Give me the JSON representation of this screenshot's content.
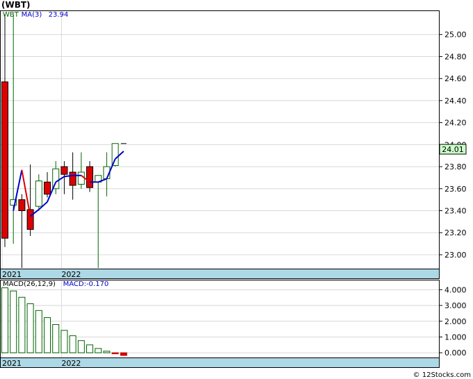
{
  "title": "(WBT)",
  "footer": "© 12Stocks.com",
  "colors": {
    "up_candle": "#006400",
    "down_candle": "#dd0000",
    "ma_up": "#0000cc",
    "ma_down": "#dd0000",
    "macd_bar": "#006400",
    "macd_negative": "#cc0000",
    "axis_band": "#add8e6",
    "price_tag_bg": "#ccffcc"
  },
  "chart_data": [
    {
      "type": "candlestick",
      "name": "price-chart",
      "legend": [
        {
          "text": "WBT",
          "color": "#006400"
        },
        {
          "text": "MA(3)",
          "color": "#0000cc"
        },
        {
          "text": "23.94",
          "color": "#0000cc"
        }
      ],
      "ylim": [
        22.88,
        25.2
      ],
      "yticks": [
        23.0,
        23.2,
        23.4,
        23.6,
        23.8,
        24.0,
        24.2,
        24.4,
        24.6,
        24.8,
        25.0
      ],
      "ytick_labels": [
        "23.00",
        "23.20",
        "23.40",
        "23.60",
        "23.80",
        "24.00",
        "24.20",
        "24.40",
        "24.60",
        "24.80",
        "25.00"
      ],
      "x_labels": [
        {
          "text": "2021",
          "index": 0
        },
        {
          "text": "2022",
          "index": 7
        }
      ],
      "last_price": "24.01",
      "candles": [
        {
          "o": 24.57,
          "h": 25.18,
          "l": 23.07,
          "c": 23.15
        },
        {
          "o": 23.45,
          "h": 25.18,
          "l": 23.1,
          "c": 23.5
        },
        {
          "o": 23.5,
          "h": 23.55,
          "l": 22.88,
          "c": 23.4
        },
        {
          "o": 23.41,
          "h": 23.82,
          "l": 23.17,
          "c": 23.23
        },
        {
          "o": 23.44,
          "h": 23.73,
          "l": 23.4,
          "c": 23.67
        },
        {
          "o": 23.66,
          "h": 23.75,
          "l": 23.52,
          "c": 23.55
        },
        {
          "o": 23.6,
          "h": 23.85,
          "l": 23.55,
          "c": 23.78
        },
        {
          "o": 23.8,
          "h": 23.85,
          "l": 23.55,
          "c": 23.73
        },
        {
          "o": 23.75,
          "h": 23.93,
          "l": 23.5,
          "c": 23.63
        },
        {
          "o": 23.64,
          "h": 23.93,
          "l": 23.6,
          "c": 23.75
        },
        {
          "o": 23.8,
          "h": 23.85,
          "l": 23.57,
          "c": 23.61
        },
        {
          "o": 23.66,
          "h": 23.71,
          "l": 22.88,
          "c": 23.72
        },
        {
          "o": 23.69,
          "h": 23.93,
          "l": 23.53,
          "c": 23.8
        },
        {
          "o": 23.81,
          "h": 24.01,
          "l": 23.8,
          "c": 24.01
        },
        {
          "o": 24.01,
          "h": 24.01,
          "l": 24.01,
          "c": 24.01
        }
      ],
      "ma": [
        null,
        23.4,
        23.77,
        23.35,
        23.41,
        23.48,
        23.66,
        23.71,
        23.72,
        23.72,
        23.66,
        23.66,
        23.69,
        23.87,
        23.94
      ]
    },
    {
      "type": "bar",
      "name": "macd-chart",
      "legend": [
        {
          "text": "MACD(26,12,9)",
          "color": "#000000"
        },
        {
          "text": "MACD:-0.170",
          "color": "#0000cc"
        }
      ],
      "ylim": [
        -0.3,
        4.5
      ],
      "yticks": [
        0,
        1,
        2,
        3,
        4
      ],
      "ytick_labels": [
        "0.000",
        "1.000",
        "2.000",
        "3.000",
        "4.000"
      ],
      "x_labels": [
        {
          "text": "2021",
          "index": 0
        },
        {
          "text": "2022",
          "index": 7
        }
      ],
      "values": [
        4.12,
        3.92,
        3.52,
        3.11,
        2.68,
        2.23,
        1.79,
        1.42,
        1.08,
        0.77,
        0.5,
        0.27,
        0.1,
        -0.03,
        -0.17
      ]
    }
  ]
}
